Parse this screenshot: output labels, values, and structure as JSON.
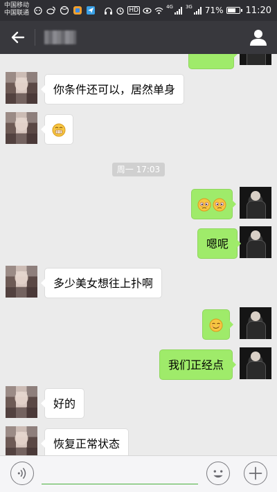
{
  "status_bar": {
    "carrier_1": "中国移动",
    "carrier_2": "中国联通",
    "hd_label": "HD",
    "net_tag_1": "4G",
    "net_tag_2": "3G",
    "battery_text": "71%",
    "battery_percent": 71,
    "time": "11:20"
  },
  "chat": {
    "timestamp": "周一 17:03",
    "messages": [
      {
        "from": "friend",
        "type": "text",
        "text": "你条件还可以，居然单身"
      },
      {
        "from": "friend",
        "type": "emoji",
        "emoji": [
          "grin-icon"
        ]
      },
      {
        "from": "self",
        "type": "emoji",
        "emoji": [
          "angry-eyes-icon",
          "angry-eyes-icon"
        ]
      },
      {
        "from": "self",
        "type": "text",
        "text": "嗯呢"
      },
      {
        "from": "friend",
        "type": "text",
        "text": "多少美女想往上扑啊"
      },
      {
        "from": "self",
        "type": "emoji",
        "emoji": [
          "smirk-icon"
        ]
      },
      {
        "from": "self",
        "type": "text",
        "text": "我们正经点"
      },
      {
        "from": "friend",
        "type": "text",
        "text": "好的"
      },
      {
        "from": "friend",
        "type": "text",
        "text": "恢复正常状态"
      }
    ]
  },
  "colors": {
    "title_bar": "#38383d",
    "status_bar": "#2e2e33",
    "chat_bg": "#ebebeb",
    "outgoing_bubble": "#9feb6a",
    "incoming_bubble": "#ffffff",
    "input_accent": "#47b03a"
  },
  "icons": {
    "back": "back-arrow-icon",
    "profile": "person-icon",
    "voice": "voice-icon",
    "emoji": "smiley-icon",
    "more": "plus-icon"
  }
}
